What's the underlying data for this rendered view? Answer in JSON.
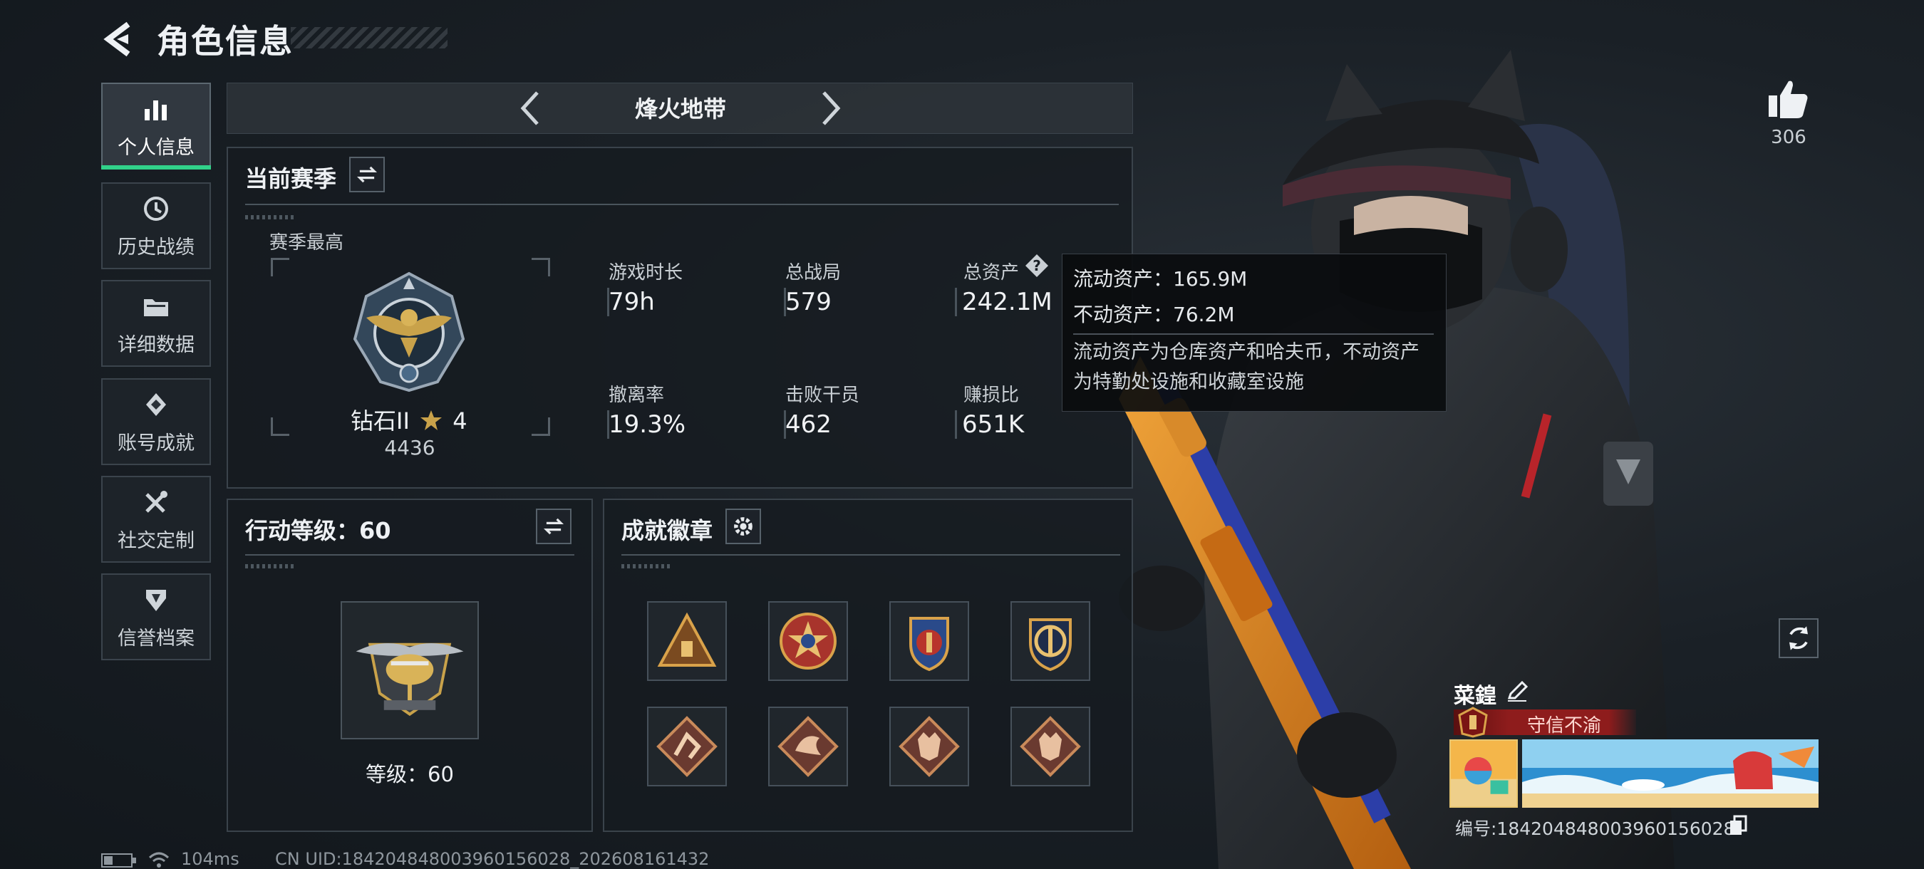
{
  "header": {
    "title": "角色信息"
  },
  "sidebar": {
    "items": [
      {
        "label": "个人信息",
        "icon": "bar-chart-icon",
        "active": true
      },
      {
        "label": "历史战绩",
        "icon": "history-clock-icon",
        "active": false
      },
      {
        "label": "详细数据",
        "icon": "folder-icon",
        "active": false
      },
      {
        "label": "账号成就",
        "icon": "achievement-icon",
        "active": false
      },
      {
        "label": "社交定制",
        "icon": "tools-icon",
        "active": false
      },
      {
        "label": "信誉档案",
        "icon": "credit-shield-icon",
        "active": false
      }
    ]
  },
  "mode": {
    "title": "烽火地带"
  },
  "season": {
    "title": "当前赛季",
    "best_label": "赛季最高",
    "rank_name": "钻石II",
    "rank_stars": "4",
    "rank_points": "4436",
    "stats": [
      {
        "label": "游戏时长",
        "value": "79h"
      },
      {
        "label": "总战局",
        "value": "579"
      },
      {
        "label": "总资产",
        "value": "242.1M"
      },
      {
        "label": "撤离率",
        "value": "19.3%"
      },
      {
        "label": "击败干员",
        "value": "462"
      },
      {
        "label": "赚损比",
        "value": "651K"
      }
    ]
  },
  "tooltip": {
    "liquid": "流动资产：165.9M",
    "fixed": "不动资产：76.2M",
    "note_line1": "流动资产为仓库资产和哈夫币，不动资产",
    "note_line2": "为特勤处设施和收藏室设施"
  },
  "action_level": {
    "title": "行动等级：60",
    "level_text": "等级：60"
  },
  "badges": {
    "title": "成就徽章",
    "items": [
      "pyramid-badge",
      "star-medal-badge",
      "shield-wreath-badge",
      "anchor-badge",
      "runner-badge",
      "dragon-badge",
      "wolf-badge",
      "wolf-badge-2"
    ]
  },
  "profile": {
    "likes": "306",
    "name": "菜鍠",
    "title_tag": "守信不渝",
    "id_text": "编号:18420484800396015602​8"
  },
  "footer": {
    "ping": "104ms",
    "uid": "CN UID:18420484800396015602​8_202608161432"
  },
  "colors": {
    "accent_green": "#31d28a",
    "title_red": "#8e1c1c",
    "panel_border": "#3a434b"
  }
}
